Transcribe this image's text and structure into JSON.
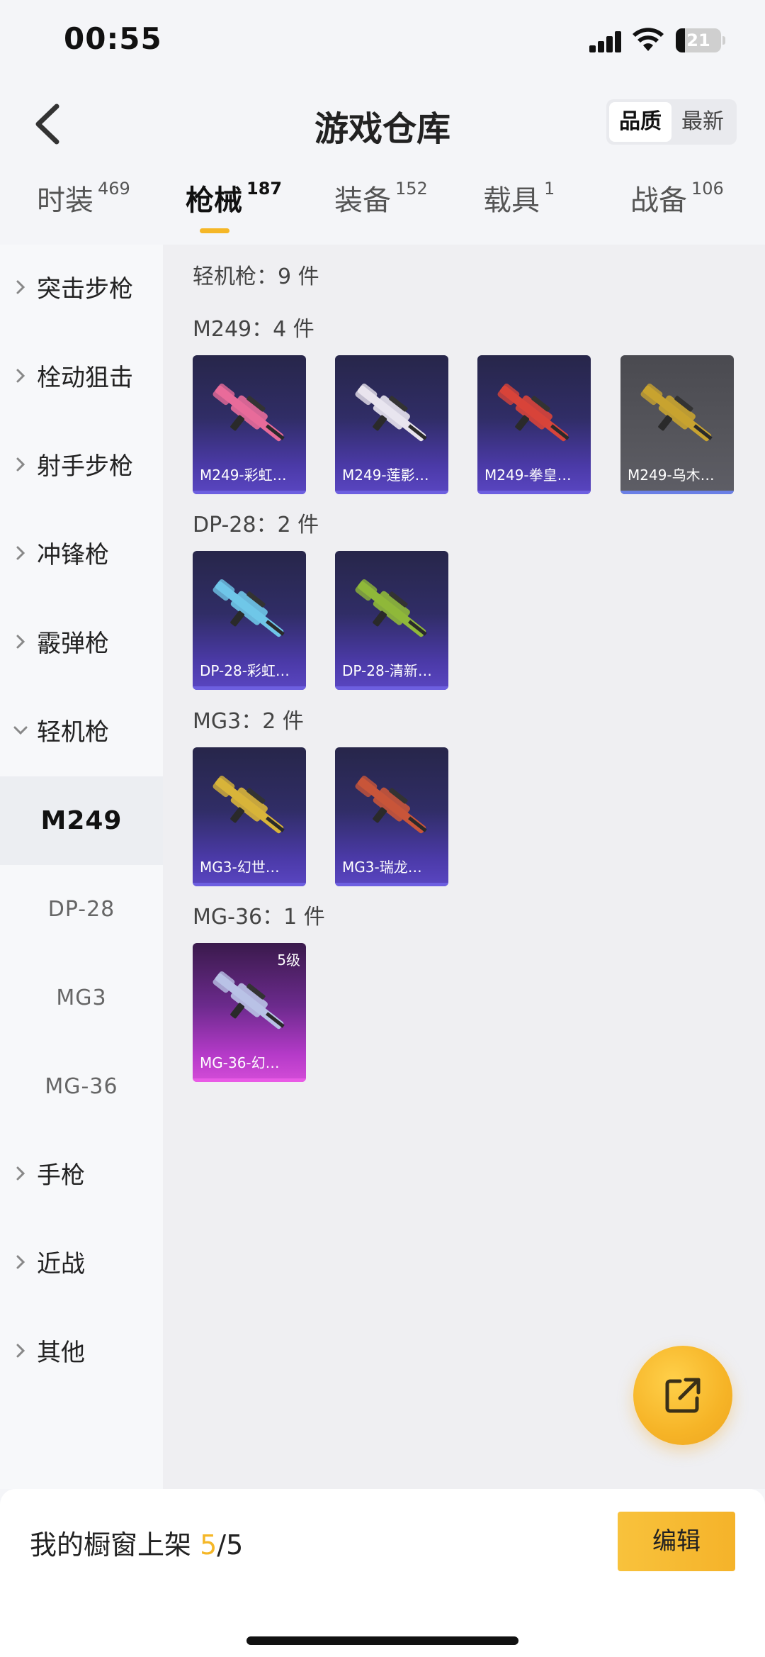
{
  "status": {
    "time": "00:55",
    "battery": "21",
    "battery_level": 0.21
  },
  "header": {
    "title": "游戏仓库",
    "sort": [
      {
        "label": "品质",
        "active": true
      },
      {
        "label": "最新",
        "active": false
      }
    ]
  },
  "tabs": [
    {
      "label": "时装",
      "count": "469",
      "active": false
    },
    {
      "label": "枪械",
      "count": "187",
      "active": true
    },
    {
      "label": "装备",
      "count": "152",
      "active": false
    },
    {
      "label": "载具",
      "count": "1",
      "active": false
    },
    {
      "label": "战备",
      "count": "106",
      "active": false
    }
  ],
  "sidebar": {
    "categories": [
      {
        "label": "突击步枪",
        "expanded": false
      },
      {
        "label": "栓动狙击",
        "expanded": false
      },
      {
        "label": "射手步枪",
        "expanded": false
      },
      {
        "label": "冲锋枪",
        "expanded": false
      },
      {
        "label": "霰弹枪",
        "expanded": false
      },
      {
        "label": "轻机枪",
        "expanded": true
      }
    ],
    "subitems": [
      {
        "label": "M249",
        "active": true
      },
      {
        "label": "DP-28",
        "active": false
      },
      {
        "label": "MG3",
        "active": false
      },
      {
        "label": "MG-36",
        "active": false
      }
    ],
    "more_categories": [
      {
        "label": "手枪"
      },
      {
        "label": "近战"
      },
      {
        "label": "其他"
      }
    ]
  },
  "content": {
    "total_label": "轻机枪：9 件",
    "groups": [
      {
        "label": "M249：4 件",
        "items": [
          {
            "name": "M249-彩虹…",
            "style": "purple",
            "gun_color": "#e86b9a"
          },
          {
            "name": "M249-莲影…",
            "style": "purple",
            "gun_color": "#e8e4ee"
          },
          {
            "name": "M249-拳皇…",
            "style": "purple",
            "gun_color": "#d8443a"
          },
          {
            "name": "M249-乌木…",
            "style": "gray",
            "gun_color": "#c8a330"
          }
        ]
      },
      {
        "label": "DP-28：2 件",
        "items": [
          {
            "name": "DP-28-彩虹…",
            "style": "purple",
            "gun_color": "#6fc6e8"
          },
          {
            "name": "DP-28-清新…",
            "style": "purple",
            "gun_color": "#8fb83a"
          }
        ]
      },
      {
        "label": "MG3：2 件",
        "items": [
          {
            "name": "MG3-幻世…",
            "style": "purple",
            "gun_color": "#d8b43a"
          },
          {
            "name": "MG3-瑞龙…",
            "style": "purple",
            "gun_color": "#c8553a"
          }
        ]
      },
      {
        "label": "MG-36：1 件",
        "items": [
          {
            "name": "MG-36-幻…",
            "style": "pink",
            "gun_color": "#b9c2e6",
            "level": "5级"
          }
        ]
      }
    ]
  },
  "footer": {
    "shelf_label": "我的橱窗上架",
    "shelf_current": "5",
    "shelf_total": "/5",
    "edit_label": "编辑"
  },
  "colors": {
    "accent": "#f5b727"
  }
}
